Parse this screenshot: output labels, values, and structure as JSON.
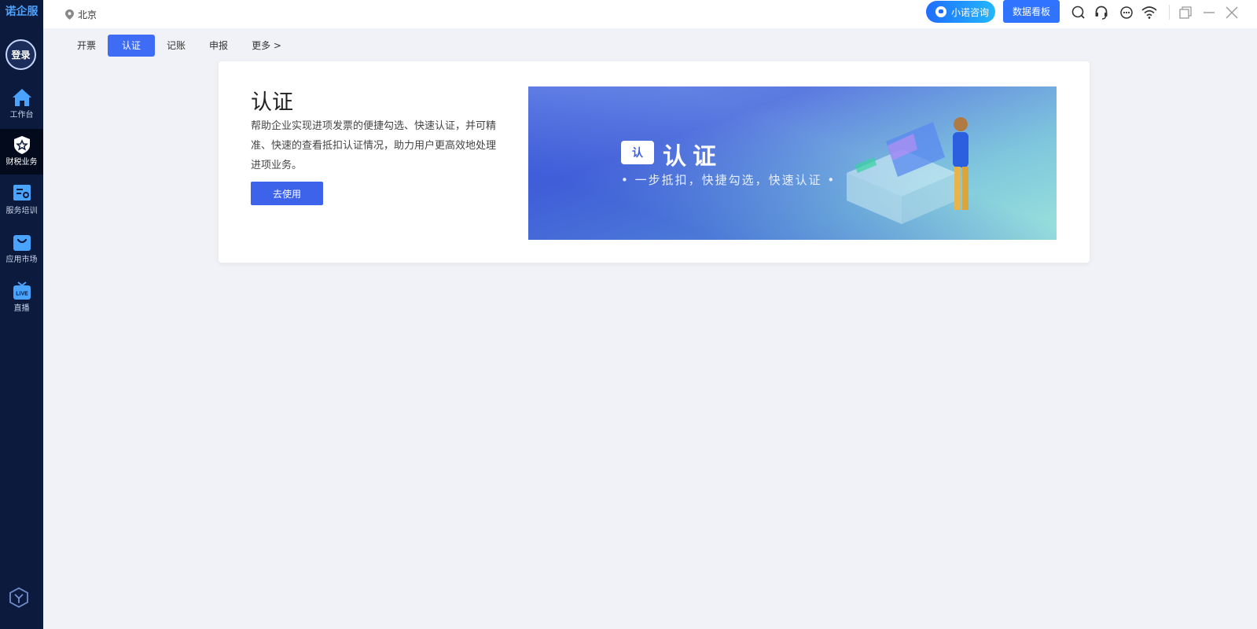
{
  "app": {
    "name": "诺企服",
    "login": "登录"
  },
  "sidebar": {
    "items": [
      {
        "label": "工作台",
        "icon": "home-icon"
      },
      {
        "label": "财税业务",
        "icon": "shield-star-icon"
      },
      {
        "label": "服务培训",
        "icon": "training-icon"
      },
      {
        "label": "应用市场",
        "icon": "bag-icon"
      },
      {
        "label": "直播",
        "icon": "live-tv-icon"
      }
    ],
    "bottom_icon": "cube-icon"
  },
  "topbar": {
    "location": "北京",
    "consult_button": "小诺咨询",
    "dashboard_button": "数据看板"
  },
  "tabs": [
    {
      "label": "开票"
    },
    {
      "label": "认证"
    },
    {
      "label": "记账"
    },
    {
      "label": "申报"
    },
    {
      "label": "更多 >"
    }
  ],
  "card": {
    "title": "认证",
    "description": "帮助企业实现进项发票的便捷勾选、快速认证，并可精准、快速的查看抵扣认证情况，助力用户更高效地处理进项业务。",
    "use_button": "去使用",
    "banner": {
      "badge": "认",
      "title": "认证",
      "subtitle": "• 一步抵扣，快捷勾选，快速认证 •"
    }
  },
  "colors": {
    "sidebar": "#0b1a3d",
    "accent": "#3f6cf5",
    "page_bg": "#f0f2f7"
  }
}
